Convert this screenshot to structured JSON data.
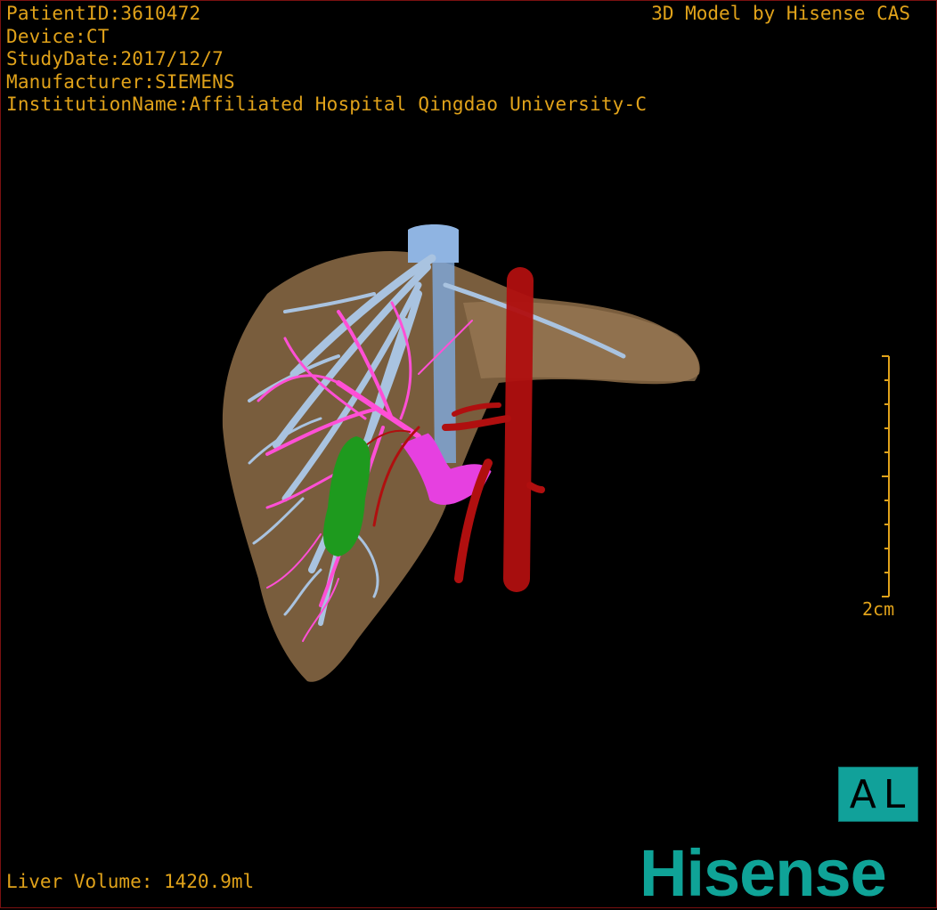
{
  "header": {
    "patient_id": "PatientID:3610472",
    "device": "Device:CT",
    "study_date": "StudyDate:2017/12/7",
    "manufacturer": "Manufacturer:SIEMENS",
    "institution": "InstitutionName:Affiliated Hospital Qingdao University-C",
    "credit": "3D Model by Hisense CAS"
  },
  "footer": {
    "liver_volume": "Liver Volume: 1420.9ml"
  },
  "scale_bar": {
    "label": "2cm"
  },
  "orientation_button": {
    "label": "AL"
  },
  "brand": {
    "logo_text": "Hisense"
  },
  "colors": {
    "text": "#e0a21a",
    "liver": "#8a6a45",
    "hepatic_vein": "#a9c3e0",
    "portal_vein": "#ff4fd6",
    "artery": "#b00f0f",
    "gallbladder": "#1e9a1e",
    "brand": "#0fa397"
  }
}
